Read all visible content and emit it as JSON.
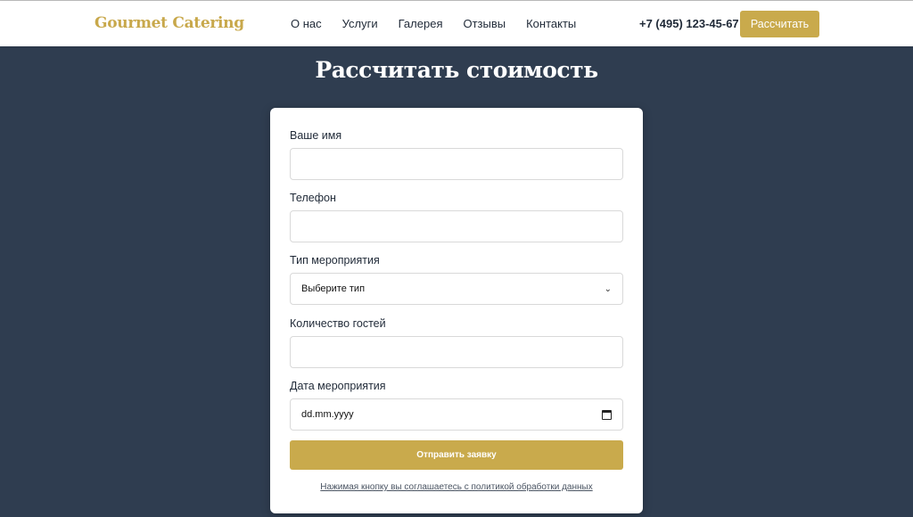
{
  "header": {
    "logo": "Gourmet Catering",
    "nav": [
      "О нас",
      "Услуги",
      "Галерея",
      "Отзывы",
      "Контакты"
    ],
    "phone": "+7 (495) 123-45-67",
    "cta_label": "Рассчитать"
  },
  "page_title": "Рассчитать стоимость",
  "form": {
    "name_label": "Ваше имя",
    "name_value": "",
    "phone_label": "Телефон",
    "phone_value": "",
    "event_type_label": "Тип мероприятия",
    "event_type_selected": "Выберите тип",
    "guests_label": "Количество гостей",
    "guests_value": "",
    "date_label": "Дата мероприятия",
    "date_placeholder": "dd.mm.yyyy",
    "submit_label": "Отправить заявку",
    "policy_text": "Нажимая кнопку вы соглашаетесь с политикой обработки данных"
  },
  "colors": {
    "accent": "#c9aa4c",
    "background": "#2f3d50",
    "card": "#ffffff"
  },
  "icons": {
    "select_arrow": "chevron-down-icon",
    "date_picker": "calendar-icon"
  }
}
